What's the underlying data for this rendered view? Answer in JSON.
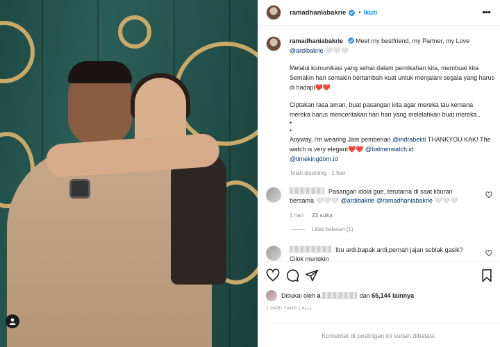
{
  "post": {
    "username": "ramadhaniabakrie",
    "follow_label": "Ikuti",
    "header_separator": "•",
    "more_icon": "more-horizontal-icon"
  },
  "caption": {
    "username": "ramadhaniabakrie",
    "line1": "Meet my bestfriend, my Partner, my Love",
    "mention1": "@ardibakrie",
    "emoji1": "🤍🤍🤍",
    "para1": "Melalui komunikasi yang sehat dalam pernikahan kita, membuat kita Semakin hari semakin bertambah kuat untuk menjalani segala yang harus di hadapi❤️❤️",
    "para2": "Ciptakan rasa aman, buat pasangan kita agar mereka tau kemana mereka harus menceritakan hari hari yang melelahkan buat mereka..",
    "bullet1": "•",
    "bullet2": "•",
    "para3_start": "Anyway, i'm wearing Jam pemberian",
    "mention2": "@indrabekti",
    "para3_mid": "THANKYOU KAK! The watch is very elegant❤️❤️",
    "mention3": "@balmerwatch.id",
    "mention4": "@timekingdom.id",
    "meta": "Telah disunting · 1 hari"
  },
  "comments": [
    {
      "text": "Pasangan idola gue, terutama di saat liburan bersama 🤍🤍🤍",
      "mention_a": "@ardibakrie",
      "mention_b": "@ramadhaniabakrie",
      "emoji": "🤍🤍🤍",
      "time": "1 hari",
      "likes": "23 suka",
      "replies_label": "Lihat balasan (1)"
    },
    {
      "text": "Ibu ardi,bapak ardi,pernah jajan seblak gasik? Cilok mungkin"
    }
  ],
  "actions": {
    "like_icon": "heart-icon",
    "comment_icon": "comment-icon",
    "share_icon": "share-icon",
    "save_icon": "bookmark-icon",
    "liked_by_prefix": "Disukai oleh",
    "liked_by_initial": "a",
    "liked_by_and": "dan",
    "liked_by_count": "65,144 lainnya",
    "date": "1 HARI YANG LALU",
    "comments_disabled": "Komentar di postingan ini sudah dibatasi."
  },
  "colors": {
    "accent": "#0095f6",
    "verified": "#3897f0",
    "mention": "#00376b",
    "muted": "#8e8e8e"
  }
}
